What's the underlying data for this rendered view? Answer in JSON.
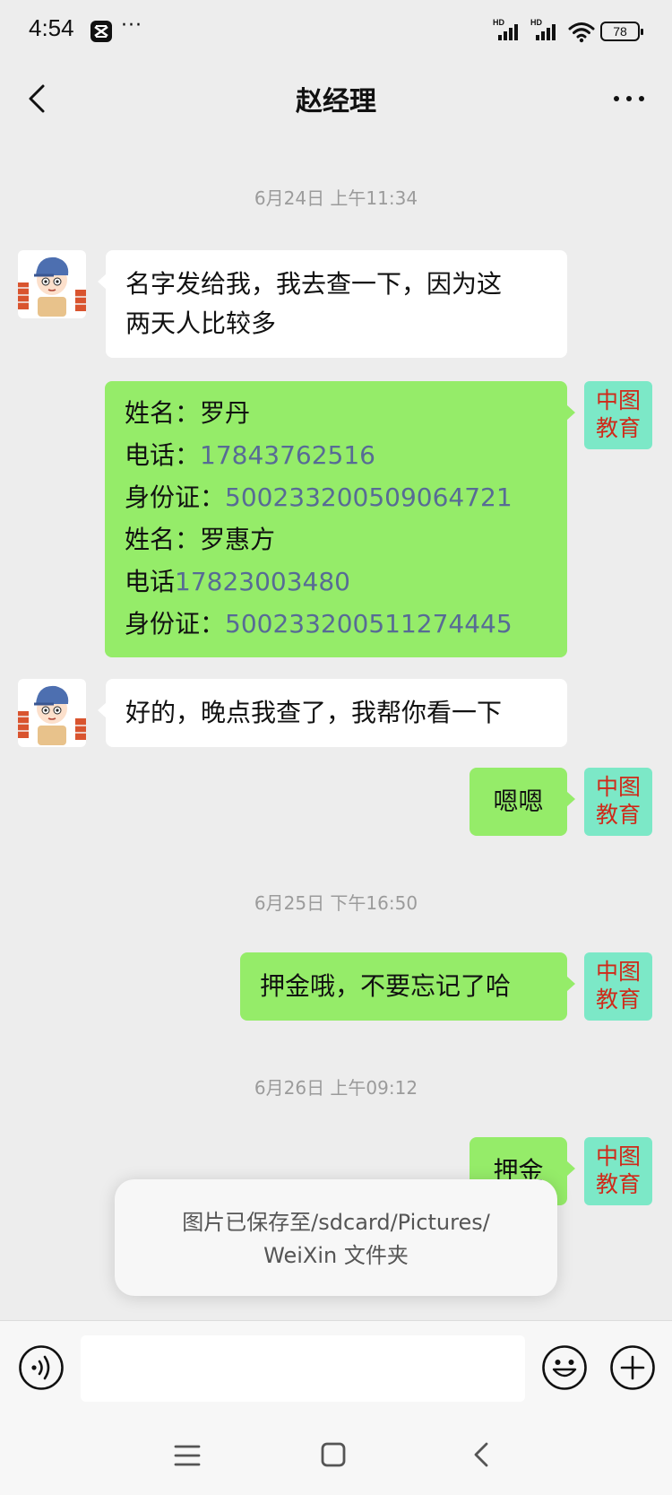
{
  "status_bar": {
    "time": "4:54",
    "battery": "78",
    "network_label_1": "HD",
    "network_label_2": "HD",
    "more": "···"
  },
  "header": {
    "title": "赵经理"
  },
  "my_avatar": {
    "line1": "中图",
    "line2": "教育"
  },
  "timestamps": [
    "6月24日 上午11:34",
    "6月25日 下午16:50",
    "6月26日 上午09:12"
  ],
  "messages": {
    "msg1_line1": "名字发给我，我去查一下，因为这",
    "msg1_line2": "两天人比较多",
    "info": [
      {
        "label": "姓名：",
        "value": "罗丹"
      },
      {
        "label": "电话：",
        "value": "17843762516"
      },
      {
        "label": "身份证：",
        "value": "500233200509064721"
      },
      {
        "label": "姓名：",
        "value": "罗惠方"
      },
      {
        "label": "电话",
        "value": "17823003480"
      },
      {
        "label": "身份证：",
        "value": "500233200511274445"
      }
    ],
    "msg3": "好的，晚点我查了，我帮你看一下",
    "msg4": "嗯嗯",
    "msg5": "押金哦，不要忘记了哈",
    "msg6": "押金"
  },
  "toast": {
    "line1": "图片已保存至/sdcard/Pictures/",
    "line2": "WeiXin 文件夹"
  },
  "input": {
    "value": "",
    "placeholder": ""
  },
  "colors": {
    "background": "#ededed",
    "outgoing_bubble": "#95ec69",
    "incoming_bubble": "#ffffff",
    "avatar_bg": "#7ce8c7",
    "avatar_text": "#cf2a1a",
    "link_number": "#576b95"
  },
  "icons": [
    "back-arrow-icon",
    "more-icon",
    "voice-icon",
    "emoji-icon",
    "plus-icon",
    "menu-icon",
    "home-icon",
    "nav-back-icon",
    "wifi-icon",
    "signal-icon",
    "battery-icon",
    "capcut-icon"
  ]
}
